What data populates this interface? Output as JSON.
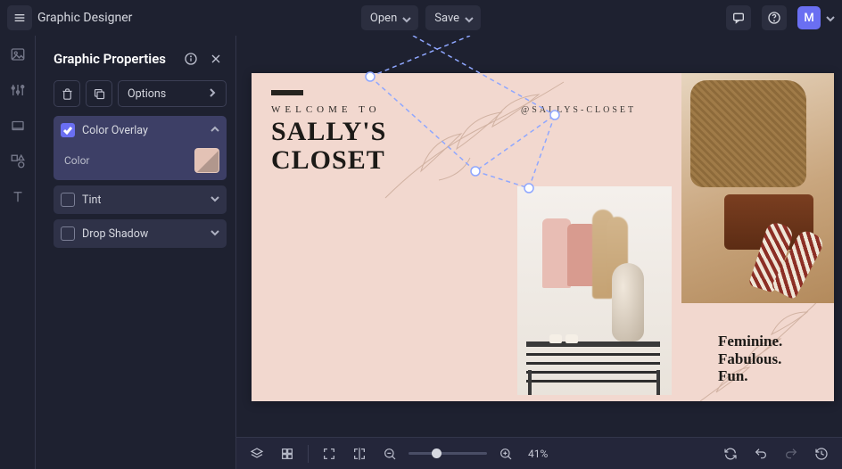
{
  "app": {
    "title": "Graphic Designer"
  },
  "menu": {
    "open": "Open",
    "save": "Save"
  },
  "user": {
    "initial": "M"
  },
  "panel": {
    "title": "Graphic Properties",
    "options": "Options",
    "groups": {
      "colorOverlay": {
        "label": "Color Overlay",
        "colorLabel": "Color",
        "colorValue": "#e3c2b5"
      },
      "tint": {
        "label": "Tint"
      },
      "dropShadow": {
        "label": "Drop Shadow"
      }
    }
  },
  "artboard": {
    "welcome": "WELCOME TO",
    "titleLine1": "SALLY'S",
    "titleLine2": "CLOSET",
    "handle": "@SALLYS-CLOSET",
    "tag1": "Feminine.",
    "tag2": "Fabulous.",
    "tag3": "Fun."
  },
  "zoom": {
    "percent": "41%",
    "position": 0.3
  }
}
